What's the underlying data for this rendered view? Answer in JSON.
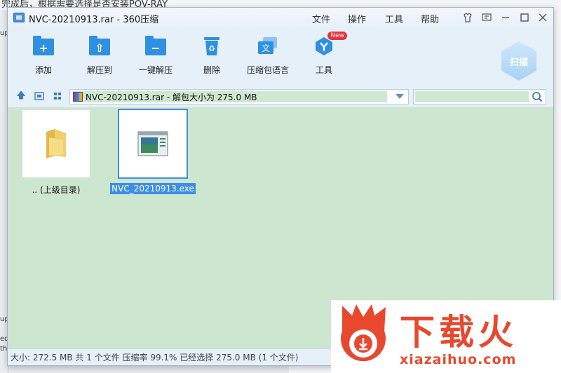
{
  "background": {
    "top_text": "完成后，根据需要选择是否安装POV-RAY",
    "left_fragments": [
      "up",
      "ed",
      "th",
      "up"
    ]
  },
  "window": {
    "title": "NVC-20210913.rar - 360压缩",
    "menu": [
      "文件",
      "操作",
      "工具",
      "帮助"
    ]
  },
  "toolbar": {
    "items": [
      {
        "label": "添加",
        "icon": "add-folder-icon"
      },
      {
        "label": "解压到",
        "icon": "extract-to-icon"
      },
      {
        "label": "一键解压",
        "icon": "one-click-extract-icon"
      },
      {
        "label": "删除",
        "icon": "recycle-bin-icon"
      },
      {
        "label": "压缩包语言",
        "icon": "language-icon"
      },
      {
        "label": "工具",
        "icon": "tools-icon",
        "badge": "New"
      }
    ],
    "scan_label": "扫描"
  },
  "address": {
    "path_text": "NVC-20210913.rar - 解包大小为 275.0 MB",
    "search_value": ""
  },
  "files": [
    {
      "name": ".. (上级目录)",
      "icon": "folder-icon",
      "selected": false
    },
    {
      "name": "NVC_20210913.exe",
      "icon": "exe-file-icon",
      "selected": true
    }
  ],
  "status": {
    "text": "大小: 272.5 MB 共 1 个文件 压缩率 99.1% 已经选择 275.0 MB (1 个文件)"
  },
  "watermark": {
    "brand": "下载火",
    "url": "xiazaihuo.com"
  },
  "colors": {
    "accent": "#3d8ee6",
    "content_bg": "#cde6cf",
    "brand_red": "#e8482e"
  }
}
